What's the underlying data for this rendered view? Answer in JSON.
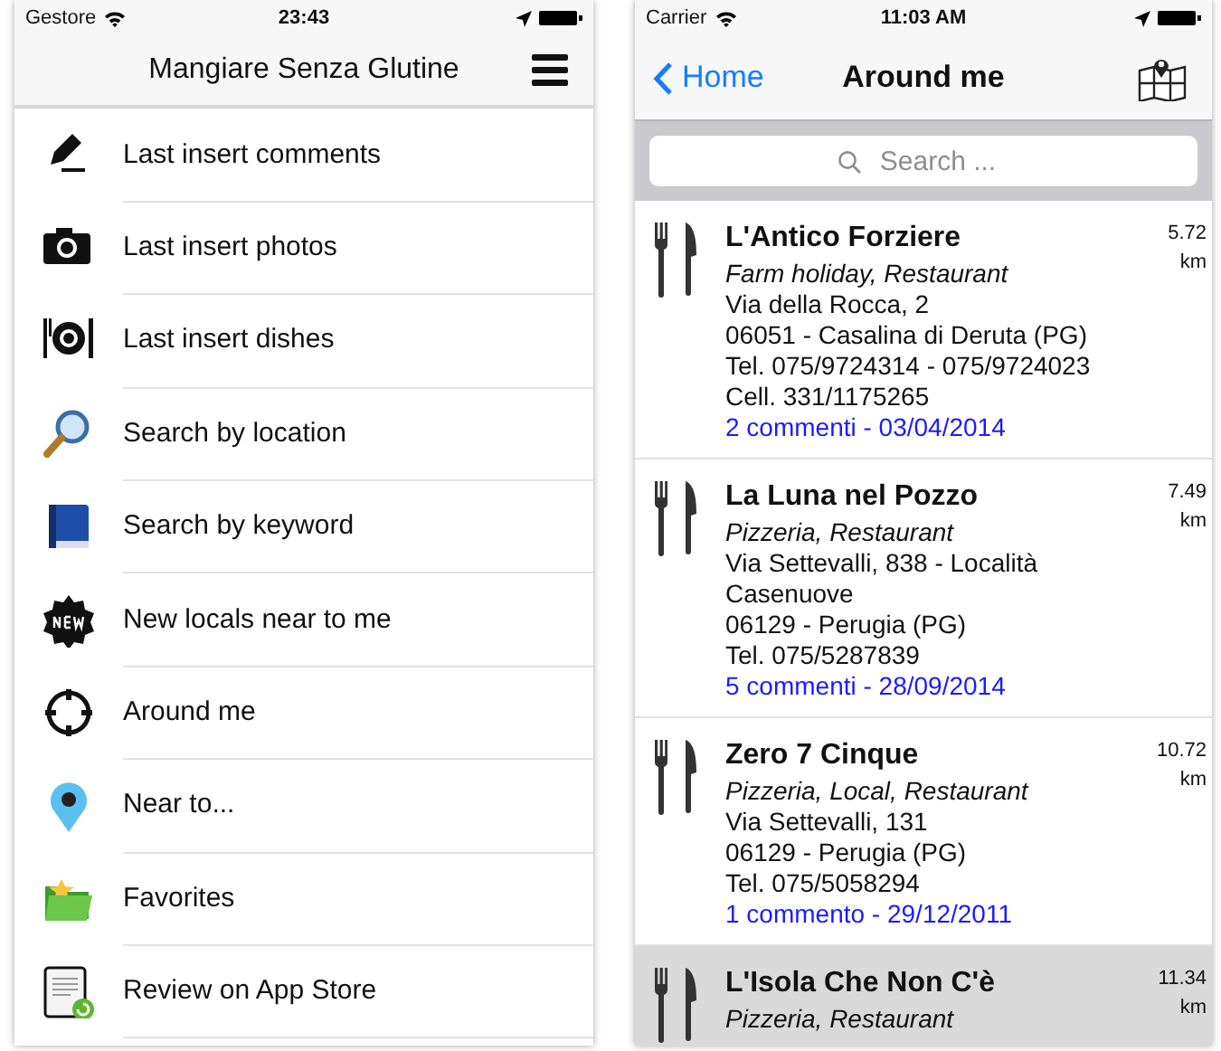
{
  "left_screen": {
    "status_bar": {
      "carrier": "Gestore",
      "time": "23:43"
    },
    "title": "Mangiare Senza Glutine",
    "menu_items": [
      {
        "label": "Last insert comments"
      },
      {
        "label": "Last insert photos"
      },
      {
        "label": "Last insert dishes"
      },
      {
        "label": "Search by location"
      },
      {
        "label": "Search by keyword"
      },
      {
        "label": "New locals near to me"
      },
      {
        "label": "Around me"
      },
      {
        "label": "Near to..."
      },
      {
        "label": "Favorites"
      },
      {
        "label": "Review on App Store"
      }
    ]
  },
  "right_screen": {
    "status_bar": {
      "carrier": "Carrier",
      "time": "11:03 AM"
    },
    "back_button": "Home",
    "title": "Around me",
    "search": {
      "placeholder": "Search ..."
    },
    "places": [
      {
        "name": "L'Antico Forziere",
        "category": "Farm holiday, Restaurant",
        "lines": [
          "Via della Rocca, 2",
          "06051 - Casalina di Deruta  (PG)",
          "Tel. 075/9724314 - 075/9724023",
          "Cell. 331/1175265"
        ],
        "comments": "2 commenti - 03/04/2014",
        "distance": "5.72",
        "unit": "km",
        "selected": false
      },
      {
        "name": "La Luna nel Pozzo",
        "category": "Pizzeria, Restaurant",
        "lines": [
          "Via Settevalli, 838 - Località Casenuove",
          "06129 - Perugia (PG)",
          "Tel. 075/5287839"
        ],
        "comments": "5 commenti - 28/09/2014",
        "distance": "7.49",
        "unit": "km",
        "selected": false
      },
      {
        "name": "Zero 7 Cinque",
        "category": "Pizzeria, Local, Restaurant",
        "lines": [
          "Via Settevalli, 131",
          "06129 - Perugia (PG)",
          "Tel. 075/5058294"
        ],
        "comments": "1 commento - 29/12/2011",
        "distance": "10.72",
        "unit": "km",
        "selected": false
      },
      {
        "name": "L'Isola Che Non C'è",
        "category": "Pizzeria, Restaurant",
        "distance": "11.34",
        "unit": "km",
        "selected": true
      }
    ]
  }
}
